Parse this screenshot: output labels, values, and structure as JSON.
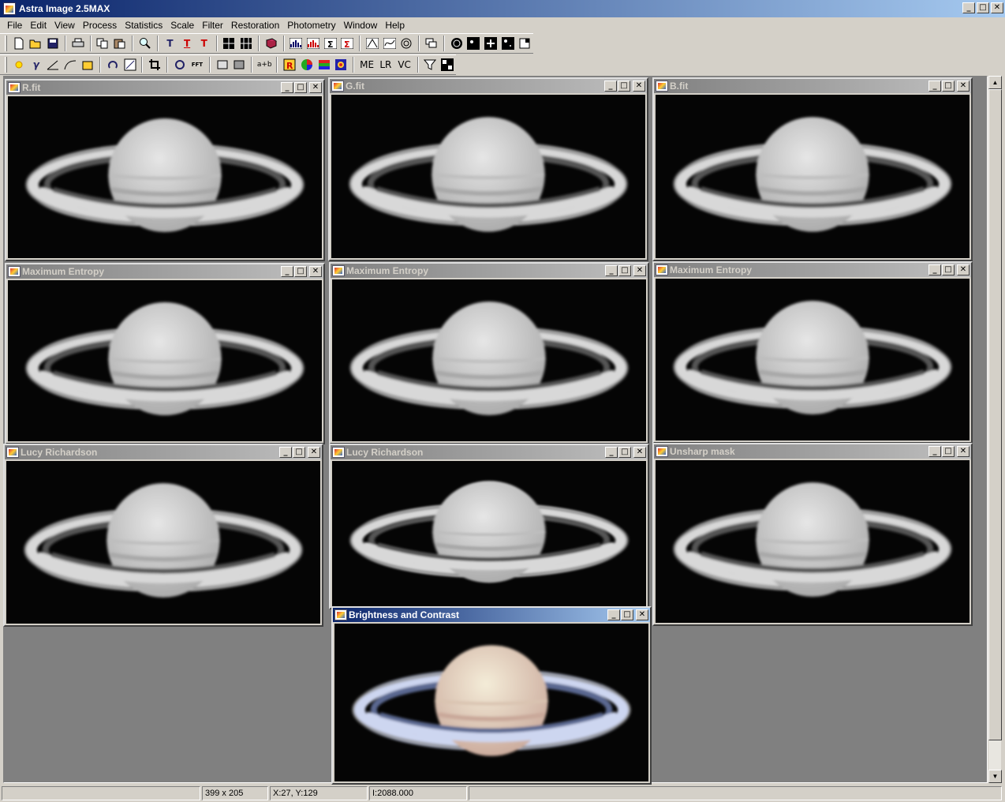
{
  "app": {
    "title": "Astra Image 2.5MAX"
  },
  "menu": [
    "File",
    "Edit",
    "View",
    "Process",
    "Statistics",
    "Scale",
    "Filter",
    "Restoration",
    "Photometry",
    "Window",
    "Help"
  ],
  "windows": [
    {
      "title": "R.fit",
      "active": false
    },
    {
      "title": "G.fit",
      "active": false
    },
    {
      "title": "B.fit",
      "active": false
    },
    {
      "title": "Maximum Entropy",
      "active": false
    },
    {
      "title": "Maximum Entropy",
      "active": false
    },
    {
      "title": "Maximum Entropy",
      "active": false
    },
    {
      "title": "Lucy Richardson",
      "active": false
    },
    {
      "title": "Lucy Richardson",
      "active": false
    },
    {
      "title": "Unsharp mask",
      "active": false
    },
    {
      "title": "Brightness and Contrast",
      "active": true
    }
  ],
  "toolbar2_text": {
    "me": "ME",
    "lr": "LR",
    "vc": "VC"
  },
  "status": {
    "dimensions": "399 x 205",
    "coords": "X:27, Y:129",
    "intensity": "I:2088.000"
  }
}
